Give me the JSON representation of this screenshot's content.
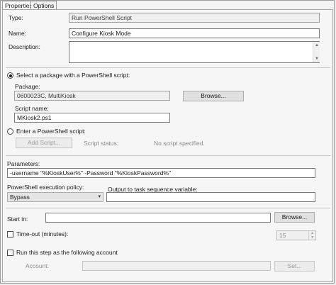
{
  "tabs": [
    {
      "label": "Properties",
      "active": true
    },
    {
      "label": "Options",
      "active": false
    }
  ],
  "type": {
    "label": "Type:",
    "value": "Run PowerShell Script"
  },
  "name": {
    "label": "Name:",
    "value": "Configure Kiosk Mode"
  },
  "description": {
    "label": "Description:",
    "value": ""
  },
  "package_option": {
    "label": "Select a package with a PowerShell script:",
    "selected": true,
    "package_label": "Package:",
    "package_value": "0600023C, MultiKiosk",
    "browse_label": "Browse...",
    "script_name_label": "Script name:",
    "script_name_value": "MKiosk2.ps1"
  },
  "script_option": {
    "label": "Enter a PowerShell script:",
    "selected": false,
    "add_script_label": "Add Script...",
    "status_label": "Script status:",
    "status_value": "No script specified."
  },
  "parameters": {
    "label": "Parameters:",
    "value": "-username \"%KioskUser%\" -Password \"%KioskPassword%\""
  },
  "execution_policy": {
    "label": "PowerShell execution policy:",
    "value": "Bypass"
  },
  "output_variable": {
    "label": "Output to task sequence variable:",
    "value": ""
  },
  "start_in": {
    "label": "Start in:",
    "value": "",
    "browse_label": "Browse..."
  },
  "timeout": {
    "label": "Time-out (minutes):",
    "checked": false,
    "value": "15"
  },
  "run_as": {
    "label": "Run this step as the following account",
    "checked": false,
    "account_label": "Account:",
    "account_value": "",
    "set_label": "Set..."
  }
}
